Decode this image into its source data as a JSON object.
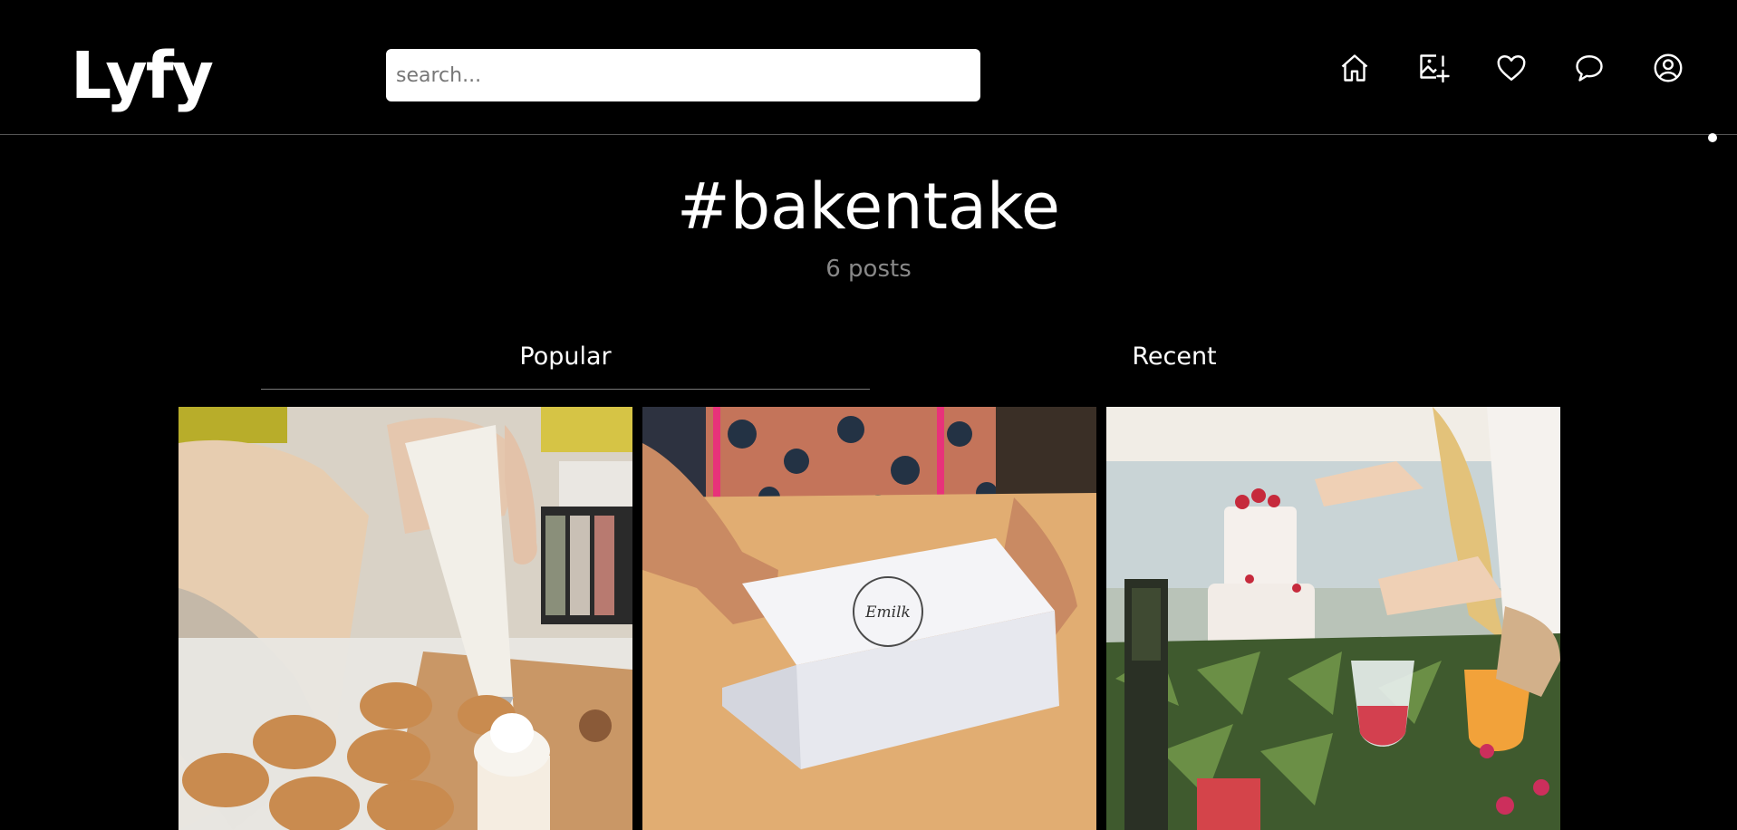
{
  "header": {
    "logo": "Lyfy",
    "search": {
      "placeholder": "search...",
      "value": ""
    },
    "nav": [
      {
        "icon": "home-icon"
      },
      {
        "icon": "add-image-icon"
      },
      {
        "icon": "heart-icon"
      },
      {
        "icon": "chat-icon"
      },
      {
        "icon": "profile-icon"
      }
    ]
  },
  "hashtag": {
    "title": "#bakentake",
    "post_count": "6 posts"
  },
  "tabs": {
    "popular": "Popular",
    "recent": "Recent",
    "active": "popular"
  },
  "posts": [
    {
      "subject": "piping-cupcakes-photo"
    },
    {
      "subject": "bakery-box-photo",
      "stamp_text": "Emilk"
    },
    {
      "subject": "decorated-cake-photo"
    }
  ]
}
